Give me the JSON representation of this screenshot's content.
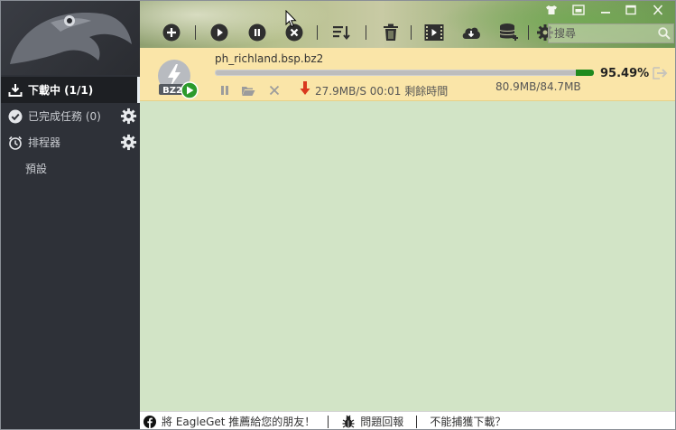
{
  "app": {
    "name": "EagleGet"
  },
  "sidebar": {
    "items": [
      {
        "label": "下載中 (1/1)",
        "icon": "download-tray-icon",
        "active": true
      },
      {
        "label": "已完成任務 (0)",
        "icon": "check-circle-icon",
        "has_settings": true
      },
      {
        "label": "排程器",
        "icon": "alarm-clock-icon",
        "has_settings": true
      },
      {
        "label": "預設",
        "sub": true
      }
    ]
  },
  "toolbar": {
    "buttons": [
      "add-icon",
      "start-icon",
      "pause-icon",
      "stop-icon",
      "sort-icon",
      "delete-icon",
      "video-icon",
      "cloud-download-icon",
      "database-icon",
      "settings-icon"
    ],
    "search_placeholder": "搜尋"
  },
  "window_controls": [
    "skin-icon",
    "mini-mode-icon",
    "minimize-icon",
    "maximize-icon",
    "close-icon"
  ],
  "download": {
    "filename": "ph_richland.bsp.bz2",
    "file_type": "BZ2",
    "progress_percent": 95.49,
    "progress_label": "95.49%",
    "speed": "27.9MB/S",
    "remaining": "00:01 剩餘時間",
    "sizes": "80.9MB/84.7MB"
  },
  "footer": {
    "recommend": "將 EagleGet 推薦給您的朋友！",
    "feedback": "問題回報",
    "cannot_capture": "不能捕獲下載？"
  },
  "colors": {
    "sidebar_bg": "#2e3138",
    "row_bg": "#fae5a8",
    "main_bg": "#d2e4c6",
    "progress_tail": "#1e8a1e",
    "speed_arrow": "#d9381e"
  }
}
